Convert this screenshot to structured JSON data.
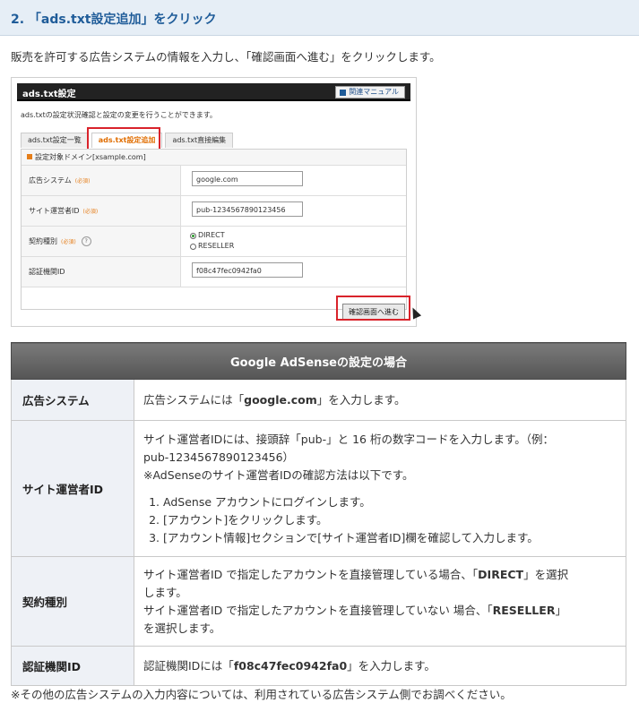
{
  "step": {
    "title": "2. 「ads.txt設定追加」をクリック"
  },
  "intro": "販売を許可する広告システムの情報を入力し、「確認画面へ進む」をクリックします。",
  "screenshot": {
    "window_title": "ads.txt設定",
    "manual_button": "関連マニュアル",
    "description": "ads.txtの設定状況確認と設定の変更を行うことができます。",
    "tabs": [
      "ads.txt設定一覧",
      "ads.txt設定追加",
      "ads.txt直接編集"
    ],
    "active_tab_index": 1,
    "domain_label": "設定対象ドメイン[xsample.com]",
    "required": "(必須)",
    "help": "?",
    "fields": {
      "ad_system": {
        "label": "広告システム",
        "value": "google.com"
      },
      "publisher_id": {
        "label": "サイト運営者ID",
        "value": "pub-1234567890123456"
      },
      "contract": {
        "label": "契約種別",
        "options": [
          "DIRECT",
          "RESELLER"
        ],
        "selected": "DIRECT"
      },
      "cert_id": {
        "label": "認証機関ID",
        "value": "f08c47fec0942fa0"
      }
    },
    "confirm_button": "確認画面へ進む"
  },
  "table": {
    "header": "Google AdSenseの設定の場合",
    "rows": [
      {
        "key": "広告システム",
        "text_a": "広告システムには「",
        "bold": "google.com",
        "text_b": "」を入力します。"
      },
      {
        "key": "サイト運営者ID",
        "line1": "サイト運営者IDには、接頭辞「pub-」と 16 桁の数字コードを入力します。（例：",
        "line2": "pub-1234567890123456）",
        "line3": "※AdSenseのサイト運営者IDの確認方法は以下です。",
        "steps": [
          "AdSense アカウントにログインします。",
          "[アカウント]をクリックします。",
          "[アカウント情報]セクションで[サイト運営者ID]欄を確認して入力します。"
        ]
      },
      {
        "key": "契約種別",
        "a1": "サイト運営者ID で指定したアカウントを直接管理している場合、「",
        "b1": "DIRECT",
        "c1": "」を選択",
        "a2": "します。",
        "a3": "サイト運営者ID で指定したアカウントを直接管理していない 場合、「",
        "b3": "RESELLER",
        "c3": "」",
        "a4": "を選択します。"
      },
      {
        "key": "認証機関ID",
        "text_a": "認証機関IDには「",
        "bold": "f08c47fec0942fa0",
        "text_b": "」を入力します。"
      }
    ]
  },
  "footnote": "※その他の広告システムの入力内容については、利用されている広告システム側でお調べください。",
  "colors": {
    "accent": "#1f5c99",
    "highlight": "#d9232b",
    "active_tab": "#e06d00"
  }
}
